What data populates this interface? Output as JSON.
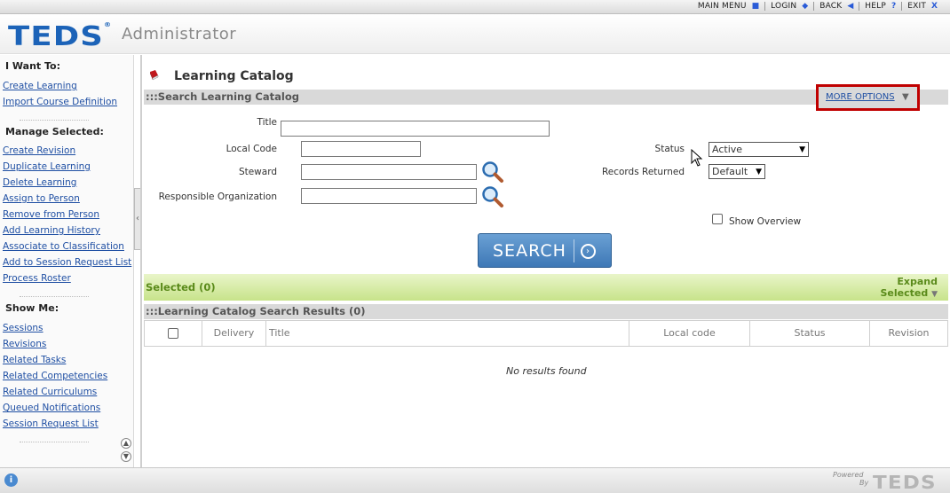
{
  "topnav": {
    "main_menu": "MAIN MENU",
    "login": "LOGIN",
    "back": "BACK",
    "help": "HELP",
    "exit": "EXIT"
  },
  "header": {
    "logo": "TEDS",
    "logo_mark": "®",
    "app_name": "Administrator"
  },
  "sidebar": {
    "i_want_to": {
      "heading": "I Want To:",
      "items": [
        "Create Learning",
        "Import Course Definition"
      ]
    },
    "manage_selected": {
      "heading": "Manage Selected:",
      "items": [
        "Create Revision",
        "Duplicate Learning",
        "Delete Learning",
        "Assign to Person",
        "Remove from Person",
        "Add Learning History",
        "Associate to Classification",
        "Add to Session Request List",
        "Process Roster"
      ]
    },
    "show_me": {
      "heading": "Show Me:",
      "items": [
        "Sessions",
        "Revisions",
        "Related Tasks",
        "Related Competencies",
        "Related Curriculums",
        "Queued Notifications",
        "Session Request List"
      ]
    }
  },
  "main": {
    "title": "Learning Catalog",
    "search_section": ":::Search Learning Catalog",
    "more_options": "MORE OPTIONS",
    "fields": {
      "title_label": "Title",
      "local_code_label": "Local Code",
      "steward_label": "Steward",
      "responsible_org_label": "Responsible Organization",
      "status_label": "Status",
      "status_value": "Active",
      "records_returned_label": "Records Returned",
      "records_returned_value": "Default",
      "show_overview_label": "Show Overview"
    },
    "search_button": "SEARCH",
    "selected_label": "Selected (0)",
    "expand_selected_line1": "Expand",
    "expand_selected_line2": "Selected",
    "results_section": ":::Learning Catalog Search Results (0)",
    "table_headers": [
      "Delivery",
      "Title",
      "Local code",
      "Status",
      "Revision"
    ],
    "no_results": "No results found"
  },
  "footer": {
    "powered_line1": "Powered",
    "powered_line2": "By",
    "powered_logo": "TEDS"
  },
  "colors": {
    "brand_blue": "#1c63b8",
    "link_blue": "#1f4fa3",
    "highlight_red": "#c00000",
    "selected_green": "#5a8a1a"
  }
}
